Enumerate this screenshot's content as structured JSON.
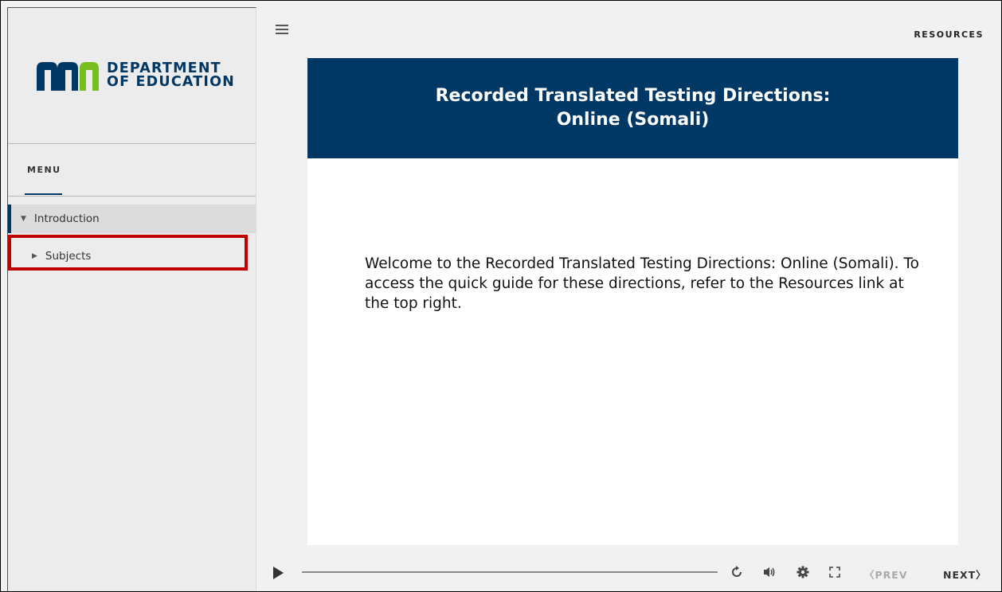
{
  "sidebar": {
    "logo": {
      "line1": "DEPARTMENT",
      "line2": "OF EDUCATION"
    },
    "menu_label": "MENU",
    "items": [
      {
        "label": "Introduction",
        "expanded": true,
        "active": true
      },
      {
        "label": "Subjects",
        "expanded": false,
        "active": false
      }
    ]
  },
  "topbar": {
    "resources_label": "RESOURCES"
  },
  "slide": {
    "title": "Recorded Translated Testing Directions:\nOnline (Somali)",
    "body": "Welcome to the Recorded Translated Testing Directions: Online (Somali). To access the quick guide for these directions, refer to the Resources link at the top right.",
    "header_color": "#003865"
  },
  "player": {
    "progress": 0.0,
    "prev_label": "PREV",
    "next_label": "NEXT"
  },
  "colors": {
    "brand": "#003865",
    "highlight": "#c00000"
  },
  "icons": [
    "hamburger-icon",
    "play-icon",
    "replay-icon",
    "volume-icon",
    "settings-icon",
    "fullscreen-icon",
    "chevron-left-icon",
    "chevron-right-icon"
  ]
}
